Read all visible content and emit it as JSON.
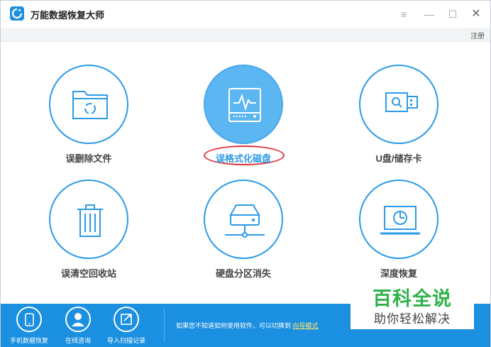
{
  "app": {
    "title": "万能数据恢复大师",
    "register_label": "注册",
    "controls": {
      "menu": "≡",
      "minimize": "—",
      "maximize": "☐",
      "close": "✕"
    }
  },
  "tiles": [
    {
      "label": "误删除文件",
      "icon": "folder-recycle-icon",
      "active": false
    },
    {
      "label": "误格式化磁盘",
      "icon": "disk-waveform-icon",
      "active": true,
      "highlighted": true
    },
    {
      "label": "U盘/储存卡",
      "icon": "usb-drive-icon",
      "active": false
    },
    {
      "label": "误清空回收站",
      "icon": "trash-icon",
      "active": false
    },
    {
      "label": "硬盘分区消失",
      "icon": "hard-drive-icon",
      "active": false
    },
    {
      "label": "深度恢复",
      "icon": "laptop-scan-icon",
      "active": false
    }
  ],
  "bottom_bar": {
    "items": [
      {
        "label": "手机数据恢复",
        "icon": "phone-icon"
      },
      {
        "label": "在线咨询",
        "icon": "person-icon"
      },
      {
        "label": "导入扫描记录",
        "icon": "import-icon"
      }
    ],
    "hint_text": "如果您不知道如何使用软件，可以切换到",
    "hint_link": "向导模式"
  },
  "watermark": {
    "title": "百科全说",
    "subtitle": "助你轻松解决"
  },
  "colors": {
    "accent": "#1b8fe0",
    "active_circle": "#5cb6f2",
    "highlight": "#e0353b",
    "watermark_green": "#2fb24a"
  }
}
